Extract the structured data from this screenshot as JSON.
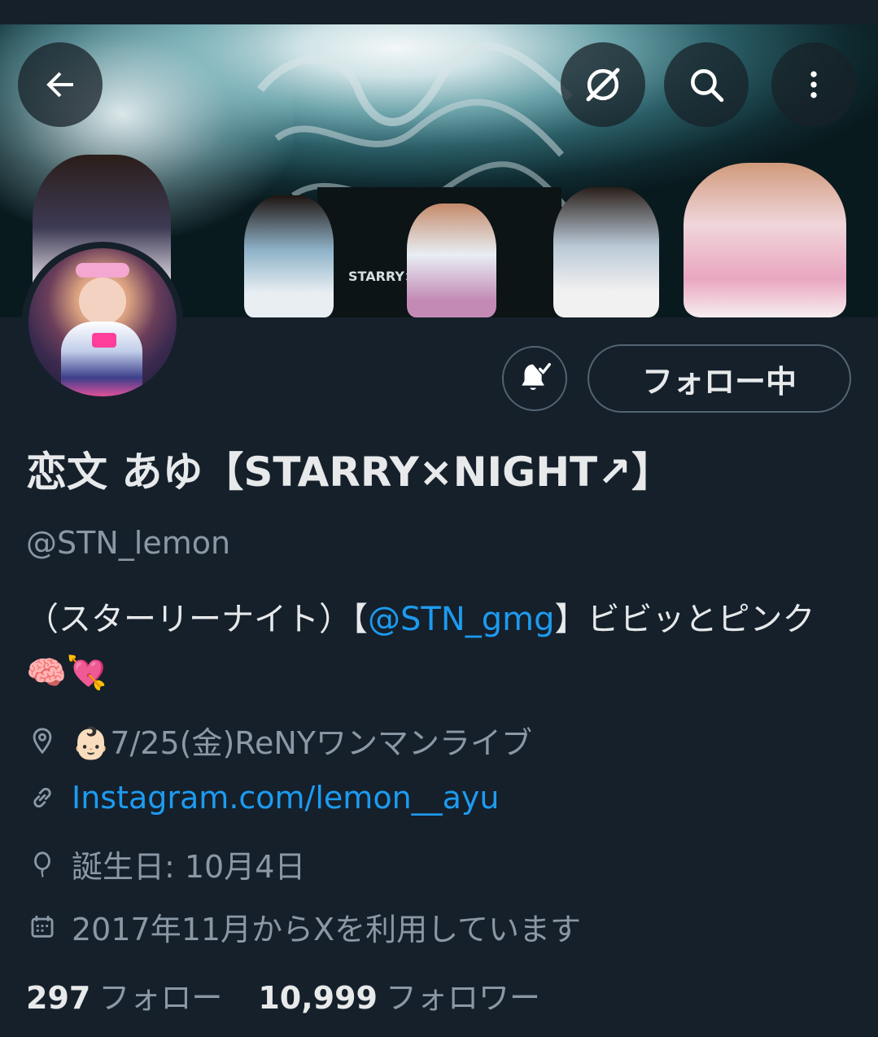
{
  "header": {
    "back_icon": "arrow-left-icon",
    "grok_icon": "grok-icon",
    "search_icon": "search-icon",
    "more_icon": "more-vertical-icon"
  },
  "banner": {
    "stage_text": "STARRY×"
  },
  "actions": {
    "notify_icon": "bell-check-icon",
    "follow_label": "フォロー中"
  },
  "profile": {
    "display_name": "恋文 あゆ【STARRY×NIGHT↗】",
    "handle": "@STN_lemon",
    "bio_prefix": "（スターリーナイト）【",
    "bio_mention": "@STN_gmg",
    "bio_suffix": "】ビビッとピンク",
    "bio_emoji": "🧠💘"
  },
  "meta": {
    "location_icon": "location-pin-icon",
    "location": "👶🏻7/25(金)ReNYワンマンライブ",
    "link_icon": "link-icon",
    "link": "Instagram.com/lemon__ayu",
    "birthday_icon": "balloon-icon",
    "birthday": "誕生日: 10月4日",
    "joined_icon": "calendar-icon",
    "joined": "2017年11月からXを利用しています"
  },
  "stats": {
    "following_count": "297",
    "following_label": "フォロー",
    "followers_count": "10,999",
    "followers_label": "フォロワー"
  },
  "colors": {
    "background": "#15202b",
    "accent": "#1d9bf0",
    "muted": "#8b98a5",
    "text": "#e7e9ea"
  }
}
